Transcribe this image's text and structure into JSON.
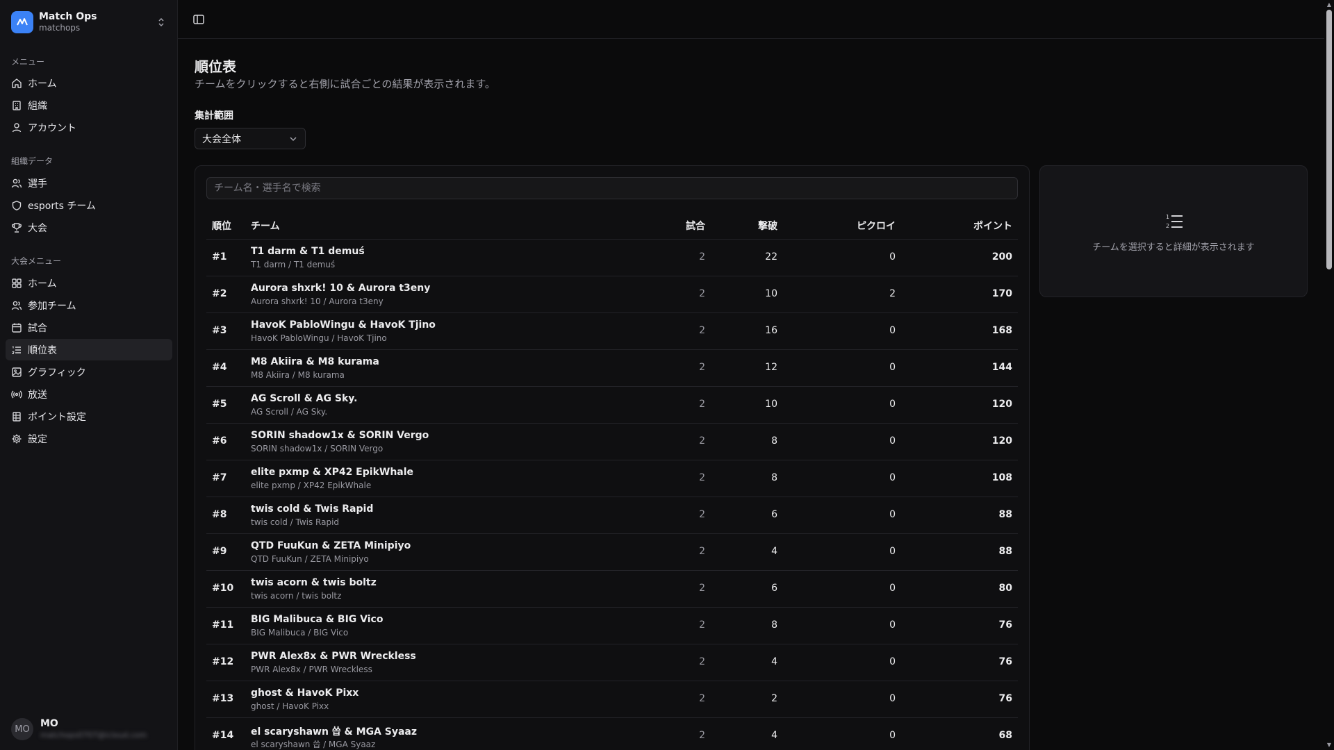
{
  "sidebar": {
    "org_name": "Match Ops",
    "org_slug": "matchops",
    "groups": [
      {
        "label": "メニュー",
        "items": [
          {
            "label": "ホーム",
            "icon": "home-icon"
          },
          {
            "label": "組織",
            "icon": "building-icon"
          },
          {
            "label": "アカウント",
            "icon": "user-icon"
          }
        ]
      },
      {
        "label": "組織データ",
        "items": [
          {
            "label": "選手",
            "icon": "users-icon"
          },
          {
            "label": "esports チーム",
            "icon": "shield-icon"
          },
          {
            "label": "大会",
            "icon": "trophy-icon"
          }
        ]
      },
      {
        "label": "大会メニュー",
        "items": [
          {
            "label": "ホーム",
            "icon": "grid-icon"
          },
          {
            "label": "参加チーム",
            "icon": "users-icon"
          },
          {
            "label": "試合",
            "icon": "calendar-icon"
          },
          {
            "label": "順位表",
            "icon": "list-ordered-icon",
            "active": true
          },
          {
            "label": "グラフィック",
            "icon": "image-icon"
          },
          {
            "label": "放送",
            "icon": "broadcast-icon"
          },
          {
            "label": "ポイント設定",
            "icon": "points-table-icon"
          },
          {
            "label": "設定",
            "icon": "gear-icon"
          }
        ]
      }
    ],
    "user": {
      "initials": "MO",
      "name": "MO",
      "email": "matchops0707@icloud.com"
    }
  },
  "page": {
    "title": "順位表",
    "description": "チームをクリックすると右側に試合ごとの結果が表示されます。",
    "range_label": "集計範囲",
    "range_value": "大会全体"
  },
  "search": {
    "placeholder": "チーム名・選手名で検索"
  },
  "table": {
    "headers": {
      "rank": "順位",
      "team": "チーム",
      "matches": "試合",
      "kills": "撃破",
      "chicken": "ピクロイ",
      "points": "ポイント"
    },
    "rows": [
      {
        "rank": "#1",
        "team": "T1 darm & T1 demuś",
        "members": "T1 darm / T1 demuś",
        "matches": "2",
        "kills": "22",
        "chicken": "0",
        "points": "200"
      },
      {
        "rank": "#2",
        "team": "Aurora shxrk! 10 & Aurora t3eny",
        "members": "Aurora shxrk! 10 / Aurora t3eny",
        "matches": "2",
        "kills": "10",
        "chicken": "2",
        "points": "170"
      },
      {
        "rank": "#3",
        "team": "HavoK PabloWingu & HavoK Tjino",
        "members": "HavoK PabloWingu / HavoK Tjino",
        "matches": "2",
        "kills": "16",
        "chicken": "0",
        "points": "168"
      },
      {
        "rank": "#4",
        "team": "M8 Akiira & M8 kurama",
        "members": "M8 Akiira / M8 kurama",
        "matches": "2",
        "kills": "12",
        "chicken": "0",
        "points": "144"
      },
      {
        "rank": "#5",
        "team": "AG Scroll & AG Sky.",
        "members": "AG Scroll / AG Sky.",
        "matches": "2",
        "kills": "10",
        "chicken": "0",
        "points": "120"
      },
      {
        "rank": "#6",
        "team": "SORIN shadow1x & SORIN Vergo",
        "members": "SORIN shadow1x / SORIN Vergo",
        "matches": "2",
        "kills": "8",
        "chicken": "0",
        "points": "120"
      },
      {
        "rank": "#7",
        "team": "elite pxmp & XP42 EpikWhale",
        "members": "elite pxmp / XP42 EpikWhale",
        "matches": "2",
        "kills": "8",
        "chicken": "0",
        "points": "108"
      },
      {
        "rank": "#8",
        "team": "twis cold & Twis Rapid",
        "members": "twis cold / Twis Rapid",
        "matches": "2",
        "kills": "6",
        "chicken": "0",
        "points": "88"
      },
      {
        "rank": "#9",
        "team": "QTD FuuKun & ZETA Minipiyo",
        "members": "QTD FuuKun / ZETA Minipiyo",
        "matches": "2",
        "kills": "4",
        "chicken": "0",
        "points": "88"
      },
      {
        "rank": "#10",
        "team": "twis acorn & twis boltz",
        "members": "twis acorn / twis boltz",
        "matches": "2",
        "kills": "6",
        "chicken": "0",
        "points": "80"
      },
      {
        "rank": "#11",
        "team": "BIG Malibuca & BIG Vico",
        "members": "BIG Malibuca / BIG Vico",
        "matches": "2",
        "kills": "8",
        "chicken": "0",
        "points": "76"
      },
      {
        "rank": "#12",
        "team": "PWR Alex8x & PWR Wreckless",
        "members": "PWR Alex8x / PWR Wreckless",
        "matches": "2",
        "kills": "4",
        "chicken": "0",
        "points": "76"
      },
      {
        "rank": "#13",
        "team": "ghost & HavoK Pixx",
        "members": "ghost / HavoK Pixx",
        "matches": "2",
        "kills": "2",
        "chicken": "0",
        "points": "76"
      },
      {
        "rank": "#14",
        "team": "el scaryshawn 씁 & MGA Syaaz",
        "members": "el scaryshawn 씁 / MGA Syaaz",
        "matches": "2",
        "kills": "4",
        "chicken": "0",
        "points": "68"
      }
    ]
  },
  "detail": {
    "empty_text": "チームを選択すると詳細が表示されます",
    "icon": "list-ordered-icon"
  },
  "colors": {
    "background": "#0b0b0c",
    "sidebar": "#131316",
    "accent": "#3b82f6",
    "border": "#232328"
  }
}
